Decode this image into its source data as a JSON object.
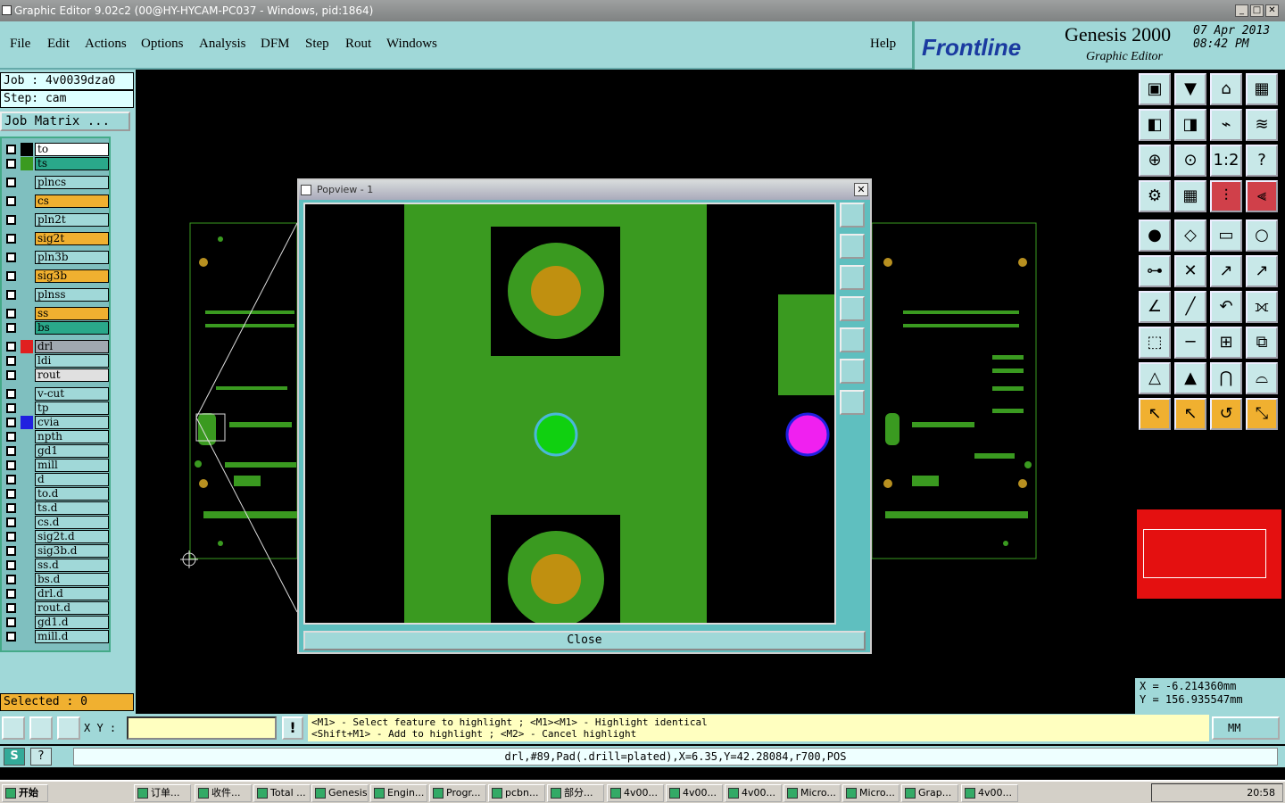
{
  "window": {
    "title": "Graphic Editor 9.02c2 (00@HY-HYCAM-PC037 - Windows, pid:1864)",
    "min": "_",
    "max": "□",
    "close": "✕"
  },
  "menu": {
    "items": [
      "File",
      "Edit",
      "Actions",
      "Options",
      "Analysis",
      "DFM",
      "Step",
      "Rout",
      "Windows"
    ],
    "help": "Help"
  },
  "brand": {
    "logo": "Frontline",
    "product": "Genesis 2000",
    "subtitle": "Graphic Editor",
    "date": "07 Apr 2013",
    "time": "08:42 PM"
  },
  "job": {
    "job": "Job : 4v0039dza0",
    "step": "Step: cam",
    "matrix_button": "Job Matrix ..."
  },
  "layers": [
    {
      "name": "to",
      "color": "#ffffff",
      "swatch": "#000000"
    },
    {
      "name": "ts",
      "color": "#2aa88a",
      "swatch": "#3a9a20"
    },
    {
      "name": "plncs",
      "color": "#a0d8d8",
      "swatch": ""
    },
    {
      "name": "cs",
      "color": "#f0b030",
      "swatch": ""
    },
    {
      "name": "pln2t",
      "color": "#a0d8d8",
      "swatch": ""
    },
    {
      "name": "sig2t",
      "color": "#f0b030",
      "swatch": ""
    },
    {
      "name": "pln3b",
      "color": "#a0d8d8",
      "swatch": ""
    },
    {
      "name": "sig3b",
      "color": "#f0b030",
      "swatch": ""
    },
    {
      "name": "plnss",
      "color": "#a0d8d8",
      "swatch": ""
    },
    {
      "name": "ss",
      "color": "#f0b030",
      "swatch": ""
    },
    {
      "name": "bs",
      "color": "#2aa88a",
      "swatch": ""
    },
    {
      "name": "drl",
      "color": "#a0a8b0",
      "swatch": "#e02020"
    },
    {
      "name": "ldi",
      "color": "#a0d8d8",
      "swatch": ""
    },
    {
      "name": "rout",
      "color": "#e0e0e0",
      "swatch": ""
    },
    {
      "name": "v-cut",
      "color": "#a0d8d8",
      "swatch": ""
    },
    {
      "name": "tp",
      "color": "#a0d8d8",
      "swatch": ""
    },
    {
      "name": "cvia",
      "color": "#a0d8d8",
      "swatch": "#2020e0"
    },
    {
      "name": "npth",
      "color": "#a0d8d8",
      "swatch": ""
    },
    {
      "name": "gd1",
      "color": "#a0d8d8",
      "swatch": ""
    },
    {
      "name": "mill",
      "color": "#a0d8d8",
      "swatch": ""
    },
    {
      "name": "d",
      "color": "#a0d8d8",
      "swatch": ""
    },
    {
      "name": "to.d",
      "color": "#a0d8d8",
      "swatch": ""
    },
    {
      "name": "ts.d",
      "color": "#a0d8d8",
      "swatch": ""
    },
    {
      "name": "cs.d",
      "color": "#a0d8d8",
      "swatch": ""
    },
    {
      "name": "sig2t.d",
      "color": "#a0d8d8",
      "swatch": ""
    },
    {
      "name": "sig3b.d",
      "color": "#a0d8d8",
      "swatch": ""
    },
    {
      "name": "ss.d",
      "color": "#a0d8d8",
      "swatch": ""
    },
    {
      "name": "bs.d",
      "color": "#a0d8d8",
      "swatch": ""
    },
    {
      "name": "drl.d",
      "color": "#a0d8d8",
      "swatch": ""
    },
    {
      "name": "rout.d",
      "color": "#a0d8d8",
      "swatch": ""
    },
    {
      "name": "gd1.d",
      "color": "#a0d8d8",
      "swatch": ""
    },
    {
      "name": "mill.d",
      "color": "#a0d8d8",
      "swatch": ""
    }
  ],
  "selected": "Selected : 0",
  "popup": {
    "title": "Popview - 1",
    "close": "Close"
  },
  "coords": {
    "x": "X = -6.214360mm",
    "y": "Y = 156.935547mm"
  },
  "input": {
    "xy_label": "X Y :",
    "value": ""
  },
  "hint": {
    "line1": "<M1> - Select feature to highlight ; <M1><M1> - Highlight identical",
    "line2": "<Shift+M1> - Add to highlight ; <M2> - Cancel highlight"
  },
  "units": "MM",
  "status": "drl,#89,Pad(.drill=plated),X=6.35,Y=42.28084,r700,POS",
  "taskbar": {
    "start": "开始",
    "items": [
      "订单...",
      "收件...",
      "Total ...",
      "Genesis",
      "Engin...",
      "Progr...",
      "pcbn...",
      "部分...",
      "4v00...",
      "4v00...",
      "4v00...",
      "Micro...",
      "Micro...",
      "Grap...",
      "4v00..."
    ],
    "clock": "20:58"
  }
}
